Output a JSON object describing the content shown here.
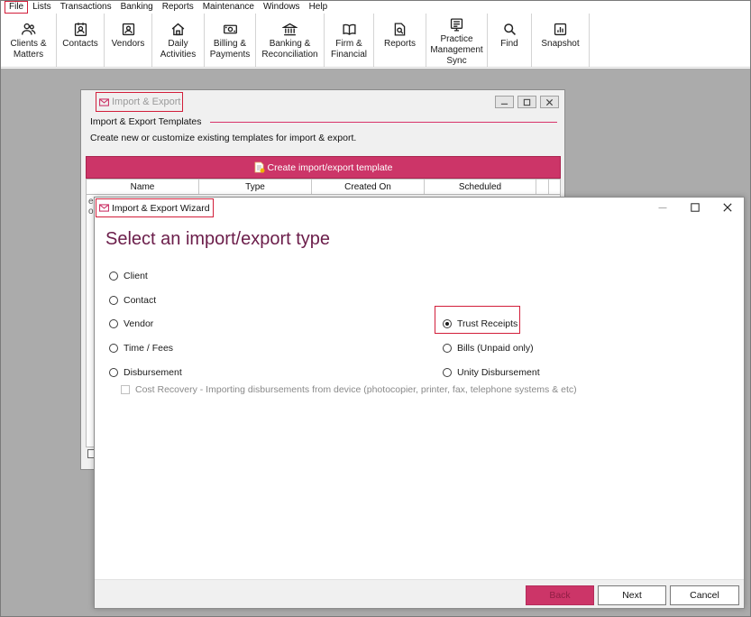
{
  "menu": {
    "items": [
      "File",
      "Lists",
      "Transactions",
      "Banking",
      "Reports",
      "Maintenance",
      "Windows",
      "Help"
    ]
  },
  "toolbar": {
    "buttons": [
      {
        "label": "Clients &\nMatters",
        "icon": "users-icon"
      },
      {
        "label": "Contacts",
        "icon": "contact-card-icon"
      },
      {
        "label": "Vendors",
        "icon": "vendor-icon"
      },
      {
        "label": "Daily\nActivities",
        "icon": "house-icon"
      },
      {
        "label": "Billing &\nPayments",
        "icon": "money-icon"
      },
      {
        "label": "Banking &\nReconciliation",
        "icon": "bank-icon"
      },
      {
        "label": "Firm &\nFinancial",
        "icon": "book-icon"
      },
      {
        "label": "Reports",
        "icon": "report-icon"
      },
      {
        "label": "Practice\nManagement\nSync",
        "icon": "sync-icon"
      },
      {
        "label": "Find",
        "icon": "search-icon"
      },
      {
        "label": "Snapshot",
        "icon": "chart-icon"
      }
    ]
  },
  "import_export_window": {
    "title": "Import & Export",
    "section_title": "Import & Export Templates",
    "description": "Create new or customize existing templates for import & export.",
    "create_button": "Create import/export template",
    "columns": [
      "Name",
      "Type",
      "Created On",
      "Scheduled"
    ],
    "row_fragment_1": "e",
    "row_fragment_2": "o"
  },
  "wizard": {
    "title": "Import & Export Wizard",
    "heading": "Select an import/export type",
    "options_left": [
      "Client",
      "Contact",
      "Vendor",
      "Time / Fees",
      "Disbursement"
    ],
    "options_right": [
      "Trust Receipts",
      "Bills (Unpaid only)",
      "Unity Disbursement"
    ],
    "selected_option": "Trust Receipts",
    "cost_recovery_label": "Cost Recovery - Importing disbursements from device (photocopier,  printer, fax, telephone systems & etc)",
    "buttons": {
      "back": "Back",
      "next": "Next",
      "cancel": "Cancel"
    }
  },
  "colors": {
    "accent": "#cc3568",
    "heading": "#6b1d4a",
    "highlight_box": "#d21e3a",
    "workspace": "#ababab"
  }
}
